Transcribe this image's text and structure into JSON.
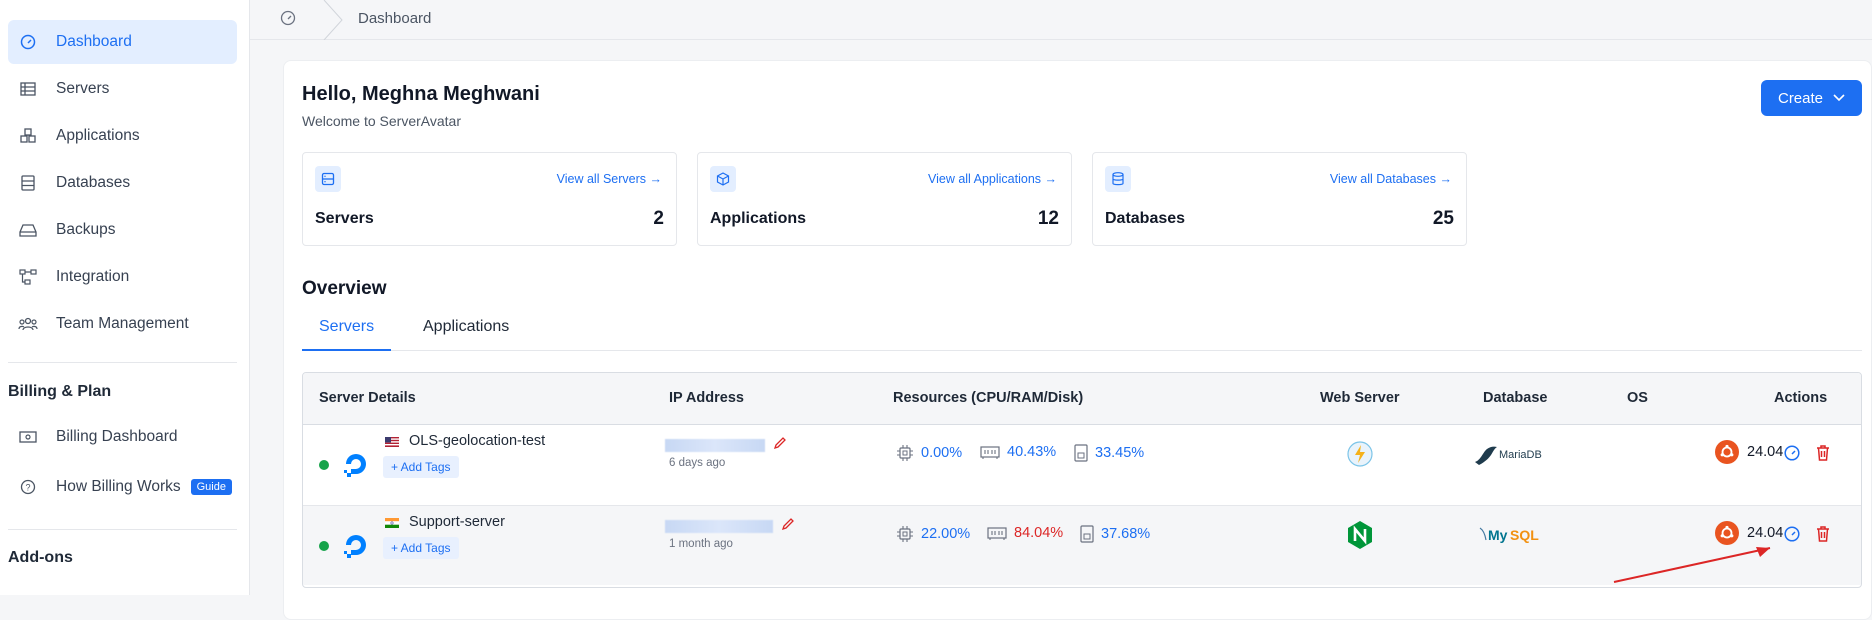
{
  "sidebar": {
    "items": [
      {
        "label": "Dashboard",
        "icon": "gauge-icon"
      },
      {
        "label": "Servers",
        "icon": "server-list-icon"
      },
      {
        "label": "Applications",
        "icon": "cubes-icon"
      },
      {
        "label": "Databases",
        "icon": "database-icon"
      },
      {
        "label": "Backups",
        "icon": "drive-icon"
      },
      {
        "label": "Integration",
        "icon": "integration-icon"
      },
      {
        "label": "Team Management",
        "icon": "team-icon"
      }
    ],
    "billing_title": "Billing & Plan",
    "billing_items": [
      {
        "label": "Billing Dashboard",
        "icon": "money-icon"
      },
      {
        "label": "How Billing Works",
        "icon": "help-icon",
        "badge": "Guide"
      }
    ],
    "addons_title": "Add-ons"
  },
  "breadcrumb": {
    "current": "Dashboard"
  },
  "header": {
    "greeting": "Hello, Meghna Meghwani",
    "subtitle": "Welcome to ServerAvatar",
    "create_label": "Create"
  },
  "stats": [
    {
      "name": "Servers",
      "count": "2",
      "link": "View all Servers"
    },
    {
      "name": "Applications",
      "count": "12",
      "link": "View all Applications"
    },
    {
      "name": "Databases",
      "count": "25",
      "link": "View all Databases"
    }
  ],
  "overview": {
    "title": "Overview",
    "tabs": [
      "Servers",
      "Applications"
    ]
  },
  "table": {
    "headers": [
      "Server Details",
      "IP Address",
      "Resources (CPU/RAM/Disk)",
      "Web Server",
      "Database",
      "OS",
      "Actions"
    ],
    "rows": [
      {
        "name": "OLS-geolocation-test",
        "flag": "us",
        "add_tags": "+ Add Tags",
        "ip_age": "6 days ago",
        "cpu": "0.00%",
        "ram": "40.43%",
        "disk": "33.45%",
        "web_server": "litespeed",
        "database": "MariaDB",
        "os": "24.04"
      },
      {
        "name": "Support-server",
        "flag": "in",
        "add_tags": "+ Add Tags",
        "ip_age": "1 month ago",
        "cpu": "22.00%",
        "ram": "84.04%",
        "disk": "37.68%",
        "web_server": "nginx",
        "database": "MySQL",
        "os": "24.04"
      }
    ]
  },
  "colors": {
    "accent": "#1d6ff2",
    "danger": "#dc2626",
    "success": "#16a34a",
    "ubuntu": "#e95420"
  }
}
